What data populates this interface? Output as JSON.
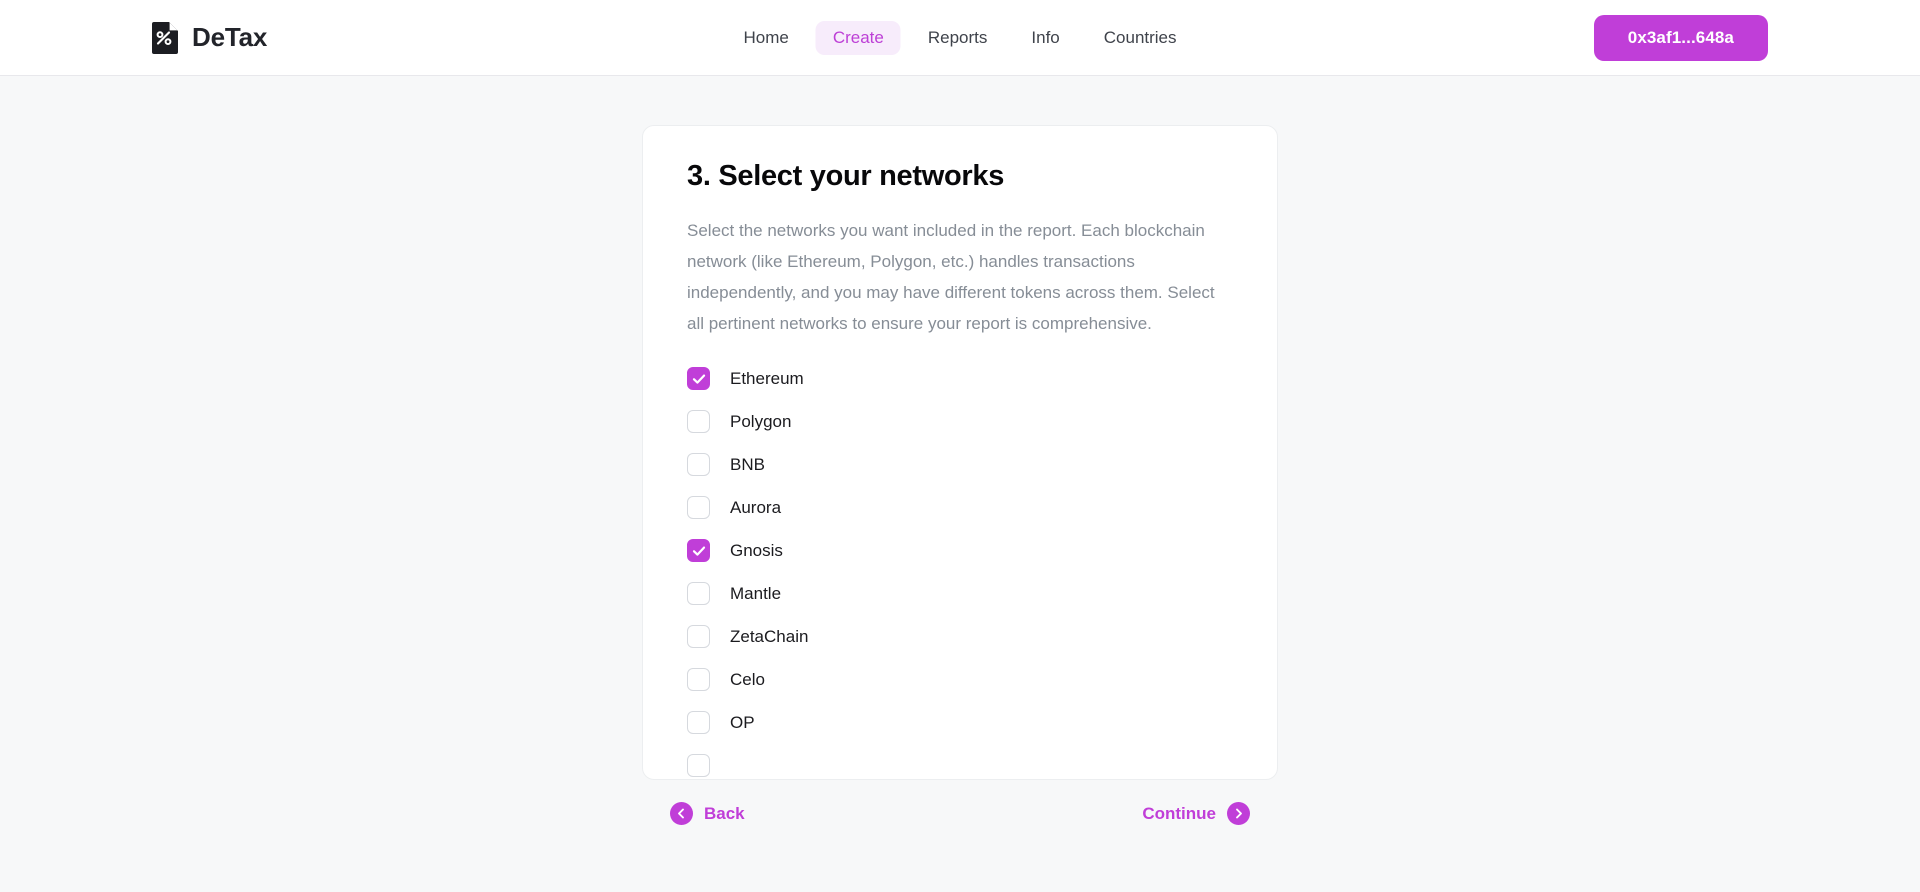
{
  "header": {
    "brand": {
      "name": "DeTax",
      "icon": "document-percent-icon"
    },
    "nav": [
      {
        "label": "Home",
        "active": false,
        "name": "nav-item-home"
      },
      {
        "label": "Create",
        "active": true,
        "name": "nav-item-create"
      },
      {
        "label": "Reports",
        "active": false,
        "name": "nav-item-reports"
      },
      {
        "label": "Info",
        "active": false,
        "name": "nav-item-info"
      },
      {
        "label": "Countries",
        "active": false,
        "name": "nav-item-countries"
      }
    ],
    "wallet_label": "0x3af1...648a"
  },
  "card": {
    "title": "3. Select your networks",
    "description": "Select the networks you want included in the report. Each blockchain network (like Ethereum, Polygon, etc.) handles transactions independently, and you may have different tokens across them. Select all pertinent networks to ensure your report is comprehensive.",
    "networks": [
      {
        "label": "Ethereum",
        "checked": true
      },
      {
        "label": "Polygon",
        "checked": false
      },
      {
        "label": "BNB",
        "checked": false
      },
      {
        "label": "Aurora",
        "checked": false
      },
      {
        "label": "Gnosis",
        "checked": true
      },
      {
        "label": "Mantle",
        "checked": false
      },
      {
        "label": "ZetaChain",
        "checked": false
      },
      {
        "label": "Celo",
        "checked": false
      },
      {
        "label": "OP",
        "checked": false
      },
      {
        "label": "",
        "checked": false
      }
    ]
  },
  "wizard": {
    "back_label": "Back",
    "continue_label": "Continue"
  },
  "colors": {
    "accent": "#c03ed8",
    "accent_soft": "#f7ecfb",
    "page_bg": "#f7f8f9",
    "card_bg": "#ffffff",
    "muted_text": "#868d96"
  }
}
